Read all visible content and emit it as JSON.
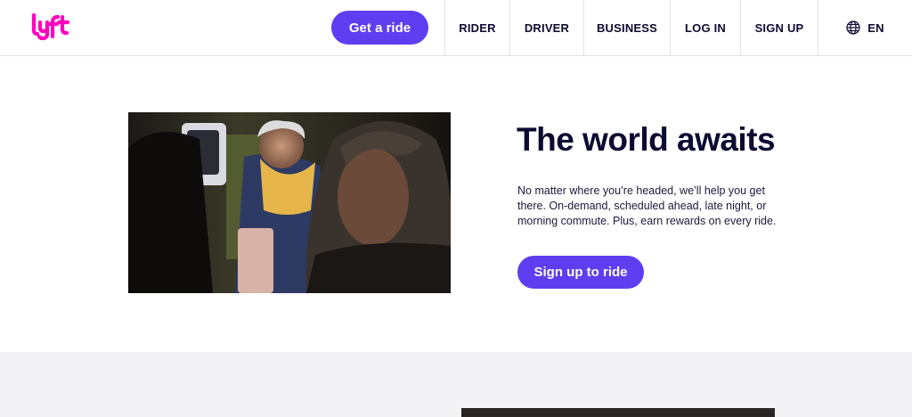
{
  "header": {
    "logo_alt": "lyft",
    "get_ride_label": "Get a ride",
    "nav": {
      "rider": "RIDER",
      "driver": "DRIVER",
      "business": "BUSINESS",
      "login": "LOG IN",
      "signup": "SIGN UP",
      "language": "EN"
    }
  },
  "hero": {
    "title": "The world awaits",
    "body": "No matter where you’re headed, we’ll help you get there. On-demand, scheduled ahead, late night, or morning commute. Plus, earn rewards on every ride.",
    "cta_label": "Sign up to ride"
  },
  "colors": {
    "brand_pink": "#ff00bf",
    "accent_purple": "#5f3df0",
    "text_navy": "#0c0b31",
    "section_bg": "#f3f3f6"
  },
  "icons": {
    "logo": "lyft-logo",
    "language": "globe-icon"
  }
}
